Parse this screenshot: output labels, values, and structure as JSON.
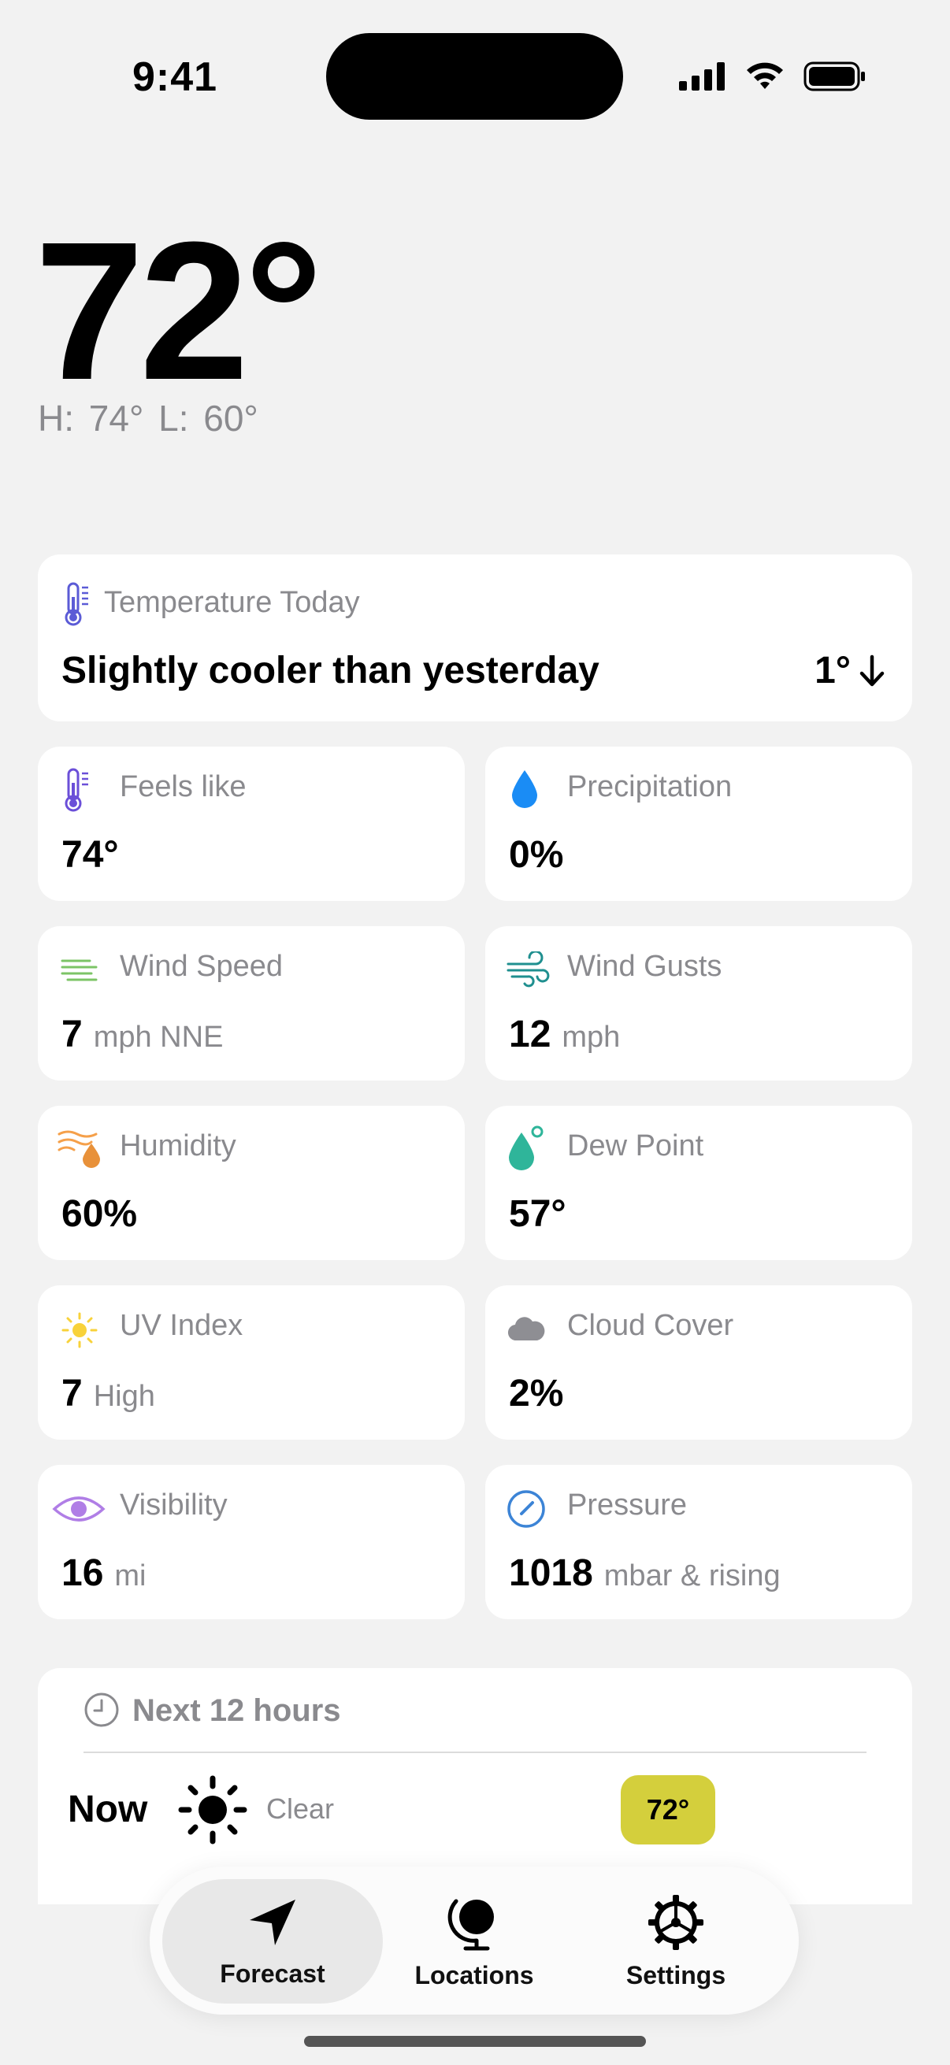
{
  "status": {
    "time": "9:41"
  },
  "hero": {
    "temp": "72°",
    "hilo": "H: 74°  L: 60°"
  },
  "temp_today": {
    "title": "Temperature Today",
    "summary": "Slightly cooler than yesterday",
    "delta": "1°"
  },
  "metrics": {
    "feels_like": {
      "label": "Feels like",
      "value": "74°",
      "unit": ""
    },
    "precipitation": {
      "label": "Precipitation",
      "value": "0%",
      "unit": ""
    },
    "wind_speed": {
      "label": "Wind Speed",
      "value": "7",
      "unit": "mph NNE"
    },
    "wind_gusts": {
      "label": "Wind Gusts",
      "value": "12",
      "unit": "mph"
    },
    "humidity": {
      "label": "Humidity",
      "value": "60%",
      "unit": ""
    },
    "dew_point": {
      "label": "Dew Point",
      "value": "57°",
      "unit": ""
    },
    "uv_index": {
      "label": "UV Index",
      "value": "7",
      "unit": "High"
    },
    "cloud_cover": {
      "label": "Cloud Cover",
      "value": "2%",
      "unit": ""
    },
    "visibility": {
      "label": "Visibility",
      "value": "16",
      "unit": "mi"
    },
    "pressure": {
      "label": "Pressure",
      "value": "1018",
      "unit": "mbar & rising"
    }
  },
  "hourly": {
    "title": "Next 12 hours",
    "rows": [
      {
        "time": "Now",
        "condition": "Clear",
        "temp": "72°",
        "badge_color": "#d4cf3c"
      }
    ]
  },
  "tabs": [
    {
      "label": "Forecast",
      "icon": "location-arrow-icon",
      "active": true
    },
    {
      "label": "Locations",
      "icon": "globe-icon",
      "active": false
    },
    {
      "label": "Settings",
      "icon": "gear-icon",
      "active": false
    }
  ]
}
